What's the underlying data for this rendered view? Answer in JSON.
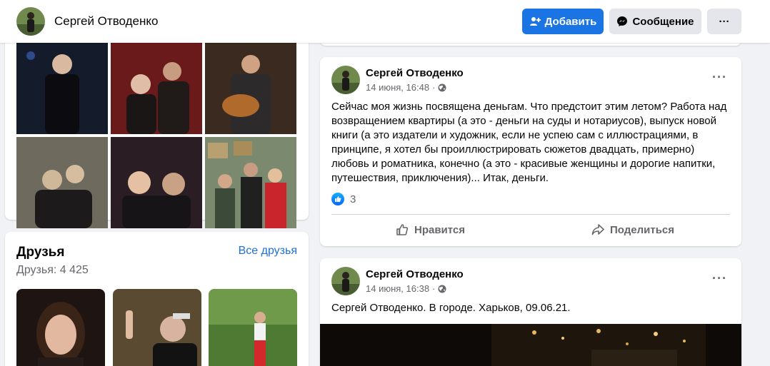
{
  "header": {
    "name": "Сергей Отводенко",
    "add_label": "Добавить",
    "message_label": "Сообщение",
    "more_label": "···"
  },
  "friends": {
    "title": "Друзья",
    "all_label": "Все друзья",
    "count_text": "Друзья: 4 425"
  },
  "posts": [
    {
      "author": "Сергей Отводенко",
      "date": "14 июня, 16:48",
      "dot": "·",
      "text": "Сейчас моя жизнь посвящена деньгам. Что предстоит этим летом? Работа над возвращением квартиры (а это - деньги на суды и нотариусов), выпуск новой книги (а это издатели и художник, если не успею сам с иллюстрациями, в принципе, я хотел бы проиллюстрировать сюжетов двадцать, примерно) любовь и роматника, конечно (а это - красивые женщины и дорогие напитки, путешествия, приключения)... Итак, деньги.",
      "reactions_count": "3",
      "like_label": "Нравится",
      "share_label": "Поделиться",
      "more_label": "···"
    },
    {
      "author": "Сергей Отводенко",
      "date": "14 июня, 16:38",
      "dot": "·",
      "text": "Сергей Отводенко. В городе. Харьков, 09.06.21.",
      "more_label": "···"
    }
  ],
  "colors": {
    "accent": "#1b74e4",
    "link": "#216fdb",
    "secondary_text": "#65676b",
    "button_gray": "#e4e6eb",
    "background": "#f0f2f5"
  }
}
